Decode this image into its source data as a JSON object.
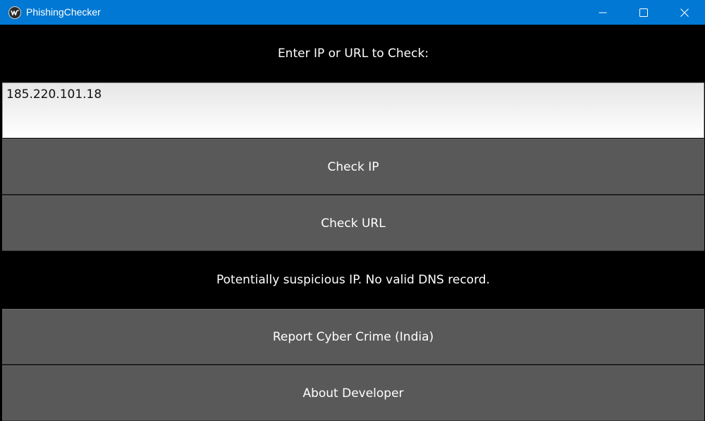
{
  "window": {
    "title": "PhishingChecker",
    "accent_color": "#0078d4",
    "icon": "kivy-logo-icon",
    "controls": [
      "minimize-icon",
      "maximize-icon",
      "close-icon"
    ]
  },
  "form": {
    "prompt": "Enter IP or URL to Check:",
    "input_value": "185.220.101.18"
  },
  "buttons": {
    "check_ip": "Check IP",
    "check_url": "Check URL",
    "report": "Report Cyber Crime (India)",
    "about": "About Developer"
  },
  "status": {
    "message": "Potentially suspicious IP. No valid DNS record."
  },
  "colors": {
    "background": "#000000",
    "button": "#595959",
    "text": "#ffffff"
  }
}
